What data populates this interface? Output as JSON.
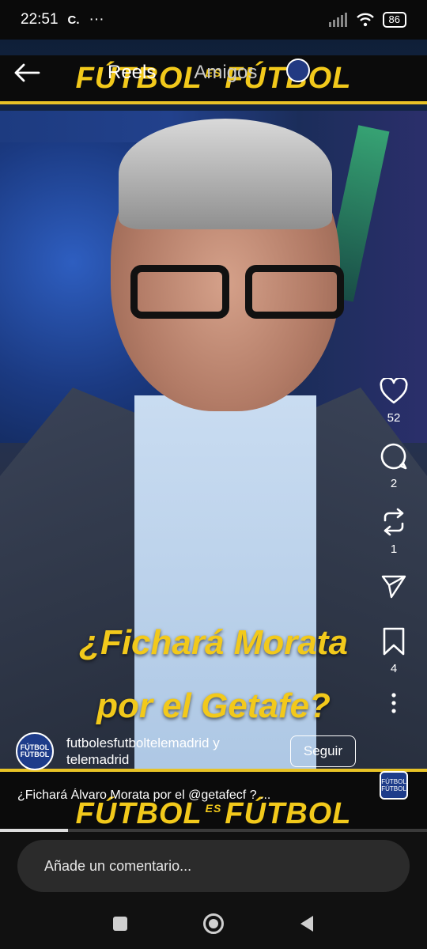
{
  "status_bar": {
    "time": "22:51",
    "notif_c": "C.",
    "notif_more": "···",
    "battery": "86"
  },
  "video": {
    "logo_left": "FÚTBOL",
    "logo_es": "ES",
    "logo_right": "FÚTBOL",
    "caption_line_1": "¿Fichará Morata",
    "caption_line_2": "por el Getafe?",
    "progress_fraction": 0.16
  },
  "header": {
    "tab_reels": "Reels",
    "tab_amigos": "Amigos"
  },
  "actions": {
    "like_count": "52",
    "comment_count": "2",
    "repost_count": "1",
    "save_count": "4"
  },
  "post": {
    "account_name": "futbolesfutboltelemadrid y telemadrid",
    "follow_label": "Seguir",
    "caption": "¿Fichará Álvaro Morata por el @getafecf ? ...",
    "avatar_text": "FÚTBOL FÚTBOL",
    "audio_thumb_text": "FÚTBOL FÚTBOL"
  },
  "comment": {
    "placeholder": "Añade un comentario..."
  },
  "colors": {
    "brand_yellow": "#f2c91b",
    "background": "#000000"
  }
}
